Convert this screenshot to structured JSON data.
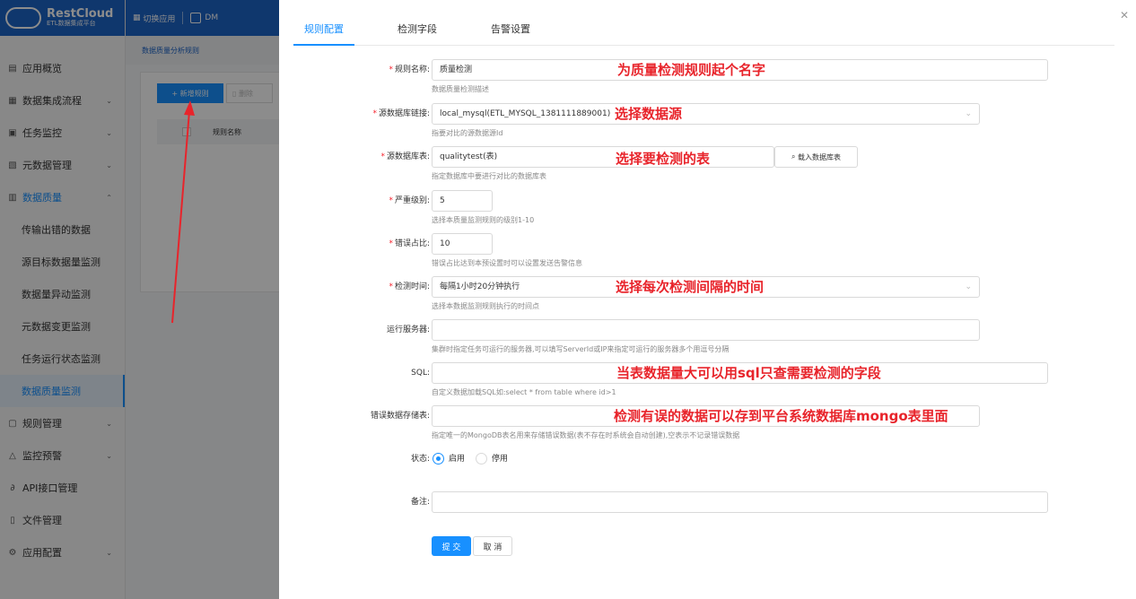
{
  "app": {
    "brand_name": "RestCloud",
    "brand_sub": "ETL数据集成平台",
    "switch_app": "切换应用",
    "env": "DM"
  },
  "sidebar": {
    "items": [
      {
        "label": "应用概览",
        "icon": "dashboard-icon"
      },
      {
        "label": "数据集成流程",
        "icon": "grid-icon"
      },
      {
        "label": "任务监控",
        "icon": "monitor-icon"
      },
      {
        "label": "元数据管理",
        "icon": "database-icon"
      },
      {
        "label": "数据质量",
        "icon": "chart-icon"
      },
      {
        "label": "传输出错的数据"
      },
      {
        "label": "源目标数据量监测"
      },
      {
        "label": "数据量异动监测"
      },
      {
        "label": "元数据变更监测"
      },
      {
        "label": "任务运行状态监测"
      },
      {
        "label": "数据质量监测"
      },
      {
        "label": "规则管理",
        "icon": "rule-icon"
      },
      {
        "label": "监控预警",
        "icon": "bell-icon"
      },
      {
        "label": "API接口管理",
        "icon": "link-icon"
      },
      {
        "label": "文件管理",
        "icon": "file-icon"
      },
      {
        "label": "应用配置",
        "icon": "gear-icon"
      }
    ]
  },
  "background": {
    "breadcrumb": "数据质量分析规则",
    "new_button": "+ 新增规则",
    "delete_button": "删除",
    "column_name": "规则名称"
  },
  "tabs": [
    "规则配置",
    "检测字段",
    "告警设置"
  ],
  "form": {
    "rule_name": {
      "label": "规则名称:",
      "value": "质量检测",
      "help": "数据质量检测描述"
    },
    "source_link": {
      "label": "源数据库链接:",
      "value": "local_mysql(ETL_MYSQL_1381111889001)",
      "help": "指要对比的源数据源Id"
    },
    "source_table": {
      "label": "源数据库表:",
      "value": "qualitytest(表)",
      "help": "指定数据库中要进行对比的数据库表",
      "load_button": "载入数据库表"
    },
    "severity": {
      "label": "严重级别:",
      "value": "5",
      "help": "选择本质量监测规则的级别1-10"
    },
    "error_ratio": {
      "label": "错误占比:",
      "value": "10",
      "help": "错误占比达到本预设置时可以设置发送告警信息"
    },
    "check_time": {
      "label": "检测时间:",
      "value": "每隔1小时20分钟执行",
      "help": "选择本数据监测规则执行的时间点"
    },
    "server": {
      "label": "运行服务器:",
      "value": "",
      "help": "集群时指定任务可运行的服务器,可以填写ServerId或IP来指定可运行的服务器多个用逗号分隔"
    },
    "sql": {
      "label": "SQL:",
      "value": "",
      "help": "自定义数据加载SQL如:select * from table where id>1"
    },
    "error_store": {
      "label": "错误数据存储表:",
      "value": "",
      "help": "指定唯一的MongoDB表名用来存储错误数据(表不存在时系统会自动创建),空表示不记录错误数据"
    },
    "status": {
      "label": "状态:",
      "enabled": "启用",
      "disabled": "停用"
    },
    "remark": {
      "label": "备注:",
      "value": ""
    },
    "submit": "提 交",
    "cancel": "取 消"
  },
  "annotations": {
    "rule_name": "为质量检测规则起个名字",
    "source_link": "选择数据源",
    "source_table": "选择要检测的表",
    "check_time": "选择每次检测间隔的时间",
    "sql": "当表数据量大可以用sql只查需要检测的字段",
    "error_store": "检测有误的数据可以存到平台系统数据库mongo表里面"
  },
  "colors": {
    "primary": "#1890ff",
    "brand": "#1d64c7",
    "annotation": "#e8242b",
    "required": "#f5222d"
  }
}
